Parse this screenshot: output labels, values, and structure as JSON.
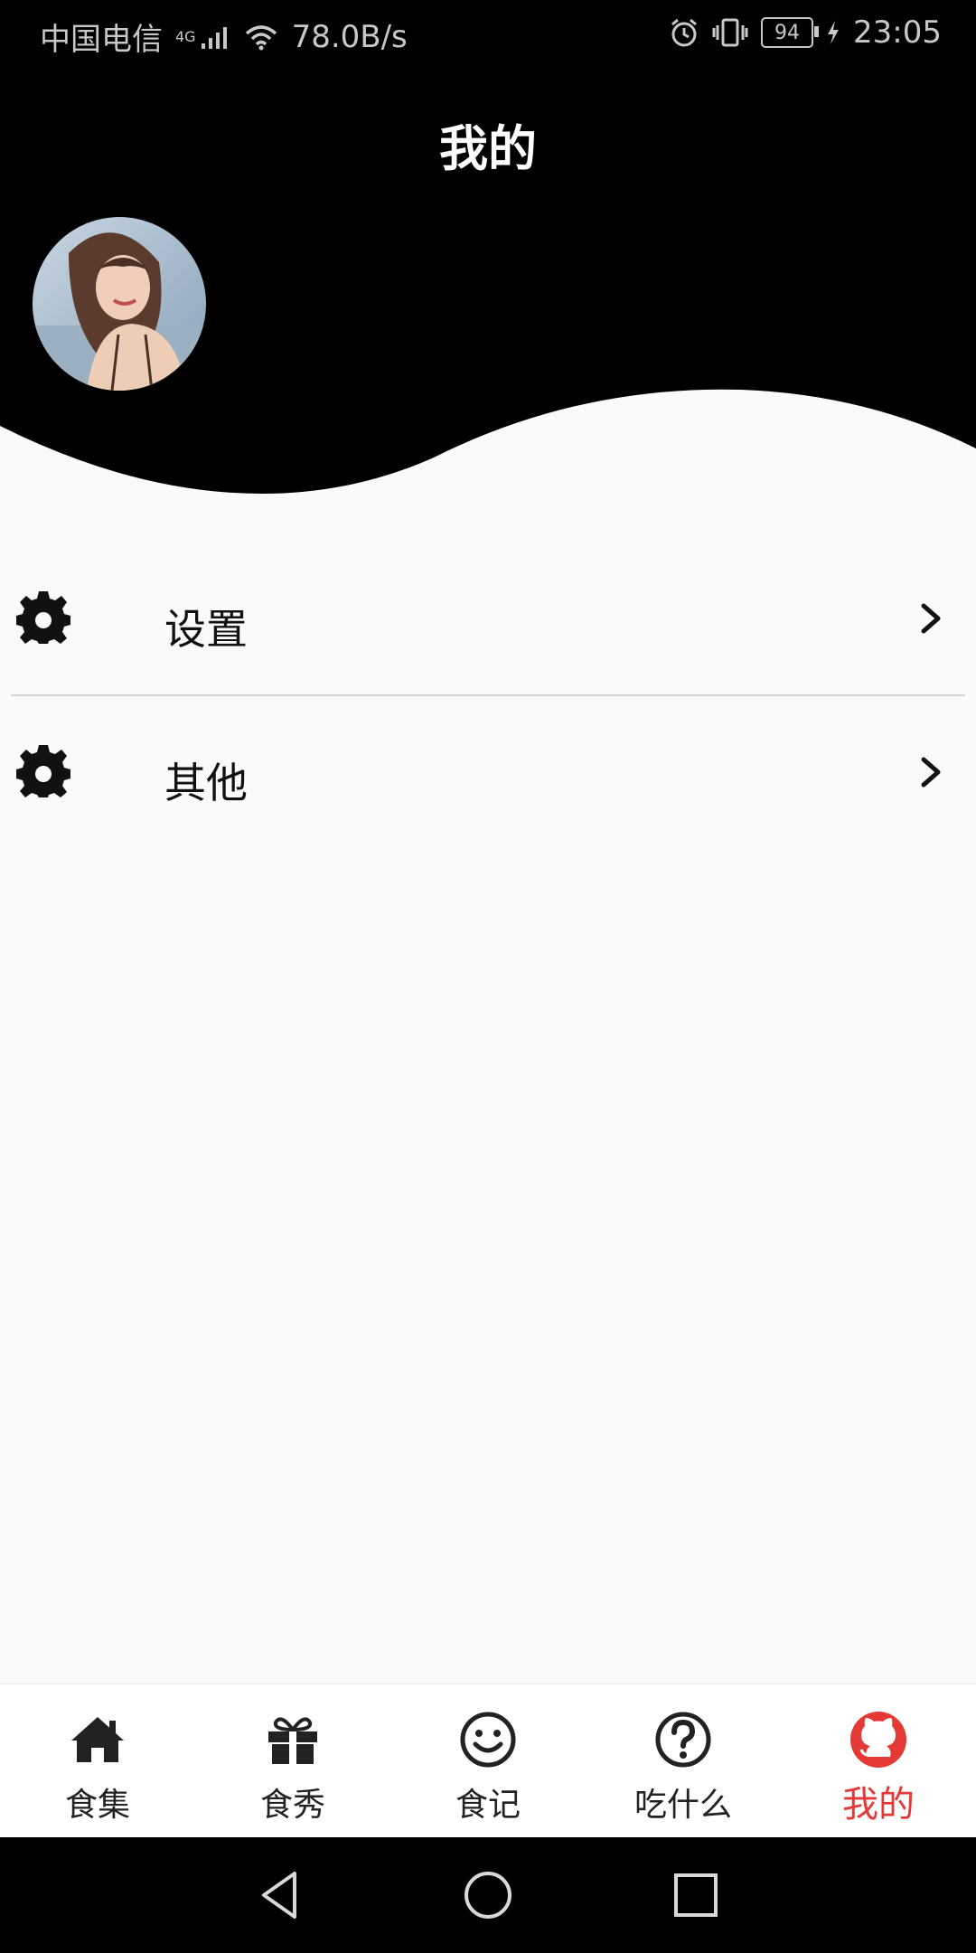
{
  "status_bar": {
    "carrier": "中国电信",
    "network": "4G",
    "speed": "78.0B/s",
    "battery": "94",
    "time": "23:05"
  },
  "header": {
    "title": "我的"
  },
  "menu": {
    "items": [
      {
        "label": "设置",
        "icon": "gear-icon"
      },
      {
        "label": "其他",
        "icon": "gear-icon"
      }
    ]
  },
  "bottom_nav": {
    "items": [
      {
        "label": "食集",
        "icon": "home-icon"
      },
      {
        "label": "食秀",
        "icon": "gift-icon"
      },
      {
        "label": "食记",
        "icon": "smiley-icon"
      },
      {
        "label": "吃什么",
        "icon": "question-circle-icon"
      },
      {
        "label": "我的",
        "icon": "github-icon"
      }
    ],
    "active_color": "#e53935"
  }
}
